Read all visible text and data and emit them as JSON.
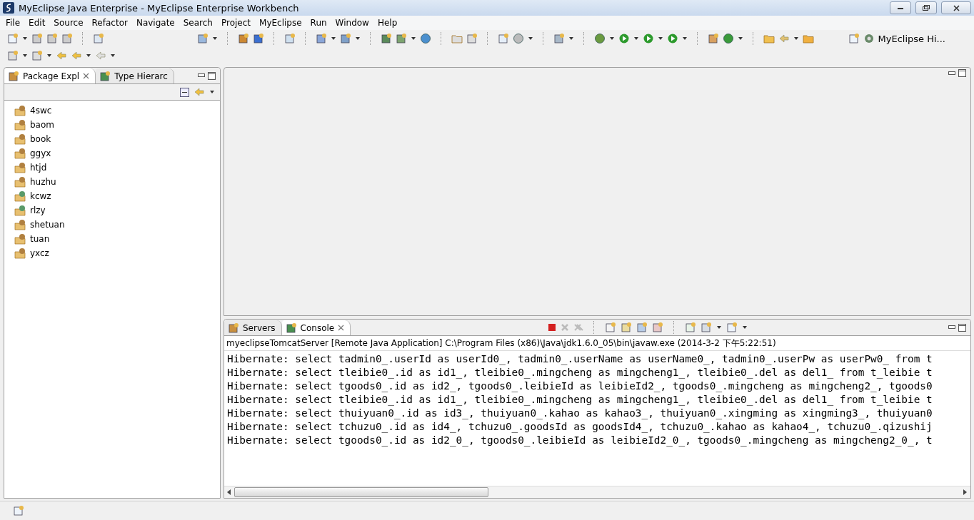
{
  "window": {
    "title": "MyEclipse Java Enterprise - MyEclipse Enterprise Workbench"
  },
  "menu": [
    "File",
    "Edit",
    "Source",
    "Refactor",
    "Navigate",
    "Search",
    "Project",
    "MyEclipse",
    "Run",
    "Window",
    "Help"
  ],
  "perspective": {
    "label": "MyEclipse Hi..."
  },
  "left_panel": {
    "tabs": [
      {
        "label": "Package Expl",
        "selected": true
      },
      {
        "label": "Type Hierarc",
        "selected": false
      }
    ],
    "tree": [
      {
        "label": "4swc",
        "kind": "project"
      },
      {
        "label": "baom",
        "kind": "project"
      },
      {
        "label": "book",
        "kind": "project"
      },
      {
        "label": "ggyx",
        "kind": "project"
      },
      {
        "label": "htjd",
        "kind": "project"
      },
      {
        "label": "huzhu",
        "kind": "project"
      },
      {
        "label": "kcwz",
        "kind": "web"
      },
      {
        "label": "rlzy",
        "kind": "web"
      },
      {
        "label": "shetuan",
        "kind": "project"
      },
      {
        "label": "tuan",
        "kind": "project"
      },
      {
        "label": "yxcz",
        "kind": "project"
      }
    ]
  },
  "console_panel": {
    "tabs": [
      {
        "label": "Servers",
        "selected": false
      },
      {
        "label": "Console",
        "selected": true
      }
    ],
    "header": "myeclipseTomcatServer [Remote Java Application] C:\\Program Files (x86)\\Java\\jdk1.6.0_05\\bin\\javaw.exe (2014-3-2 下午5:22:51)",
    "lines": [
      "Hibernate: select tadmin0_.userId as userId0_, tadmin0_.userName as userName0_, tadmin0_.userPw as userPw0_ from t",
      "Hibernate: select tleibie0_.id as id1_, tleibie0_.mingcheng as mingcheng1_, tleibie0_.del as del1_ from t_leibie t",
      "Hibernate: select tgoods0_.id as id2_, tgoods0_.leibieId as leibieId2_, tgoods0_.mingcheng as mingcheng2_, tgoods0",
      "Hibernate: select tleibie0_.id as id1_, tleibie0_.mingcheng as mingcheng1_, tleibie0_.del as del1_ from t_leibie t",
      "Hibernate: select thuiyuan0_.id as id3_, thuiyuan0_.kahao as kahao3_, thuiyuan0_.xingming as xingming3_, thuiyuan0",
      "Hibernate: select tchuzu0_.id as id4_, tchuzu0_.goodsId as goodsId4_, tchuzu0_.kahao as kahao4_, tchuzu0_.qizushij",
      "Hibernate: select tgoods0_.id as id2_0_, tgoods0_.leibieId as leibieId2_0_, tgoods0_.mingcheng as mingcheng2_0_, t"
    ]
  }
}
